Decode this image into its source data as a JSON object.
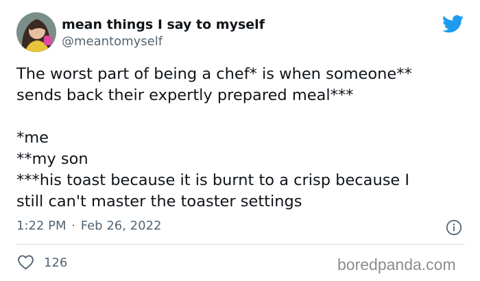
{
  "author": {
    "display_name": "mean things I say to myself",
    "handle": "@meantomyself"
  },
  "tweet": {
    "paragraph1": [
      "The worst part of being a chef* is when someone**",
      "sends back their expertly prepared meal***"
    ],
    "paragraph2": [
      "*me",
      "**my son",
      "***his toast because it is burnt to a crisp because I",
      "still can't master the toaster settings"
    ]
  },
  "meta": {
    "time": "1:22 PM",
    "separator": "·",
    "date": "Feb 26, 2022"
  },
  "engagement": {
    "likes": "126"
  },
  "watermark": "boredpanda.com",
  "icons": {
    "brand": "twitter-bird-icon",
    "info": "info-icon",
    "like": "heart-icon"
  },
  "colors": {
    "twitter_blue": "#1d9bf0",
    "secondary_text": "#536471",
    "primary_text": "#0f1419",
    "divider": "#cfd9de"
  }
}
